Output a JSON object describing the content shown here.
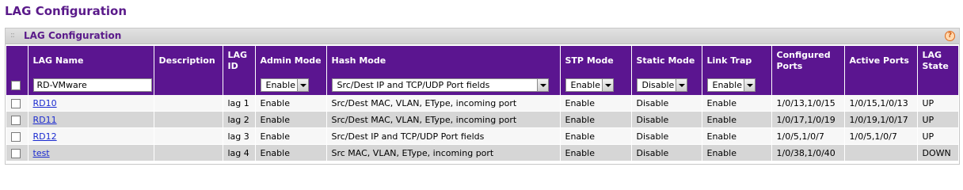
{
  "page_title": "LAG Configuration",
  "panel": {
    "title": "LAG Configuration",
    "help_icon": "help-icon"
  },
  "columns": [
    "",
    "LAG Name",
    "Description",
    "LAG ID",
    "Admin Mode",
    "Hash Mode",
    "STP Mode",
    "Static Mode",
    "Link Trap",
    "Configured Ports",
    "Active Ports",
    "LAG State"
  ],
  "filter": {
    "lag_name": "RD-VMware",
    "admin_mode": "Enable",
    "hash_mode": "Src/Dest IP and TCP/UDP Port fields",
    "stp_mode": "Enable",
    "static_mode": "Disable",
    "link_trap": "Enable"
  },
  "rows": [
    {
      "name": "RD10",
      "description": "",
      "lag_id": "lag 1",
      "admin_mode": "Enable",
      "hash_mode": "Src/Dest MAC, VLAN, EType, incoming port",
      "stp_mode": "Enable",
      "static_mode": "Disable",
      "link_trap": "Enable",
      "configured_ports": "1/0/13,1/0/15",
      "active_ports": "1/0/15,1/0/13",
      "state": "UP"
    },
    {
      "name": "RD11",
      "description": "",
      "lag_id": "lag 2",
      "admin_mode": "Enable",
      "hash_mode": "Src/Dest MAC, VLAN, EType, incoming port",
      "stp_mode": "Enable",
      "static_mode": "Disable",
      "link_trap": "Enable",
      "configured_ports": "1/0/17,1/0/19",
      "active_ports": "1/0/19,1/0/17",
      "state": "UP"
    },
    {
      "name": "RD12",
      "description": "",
      "lag_id": "lag 3",
      "admin_mode": "Enable",
      "hash_mode": "Src/Dest IP and TCP/UDP Port fields",
      "stp_mode": "Enable",
      "static_mode": "Disable",
      "link_trap": "Enable",
      "configured_ports": "1/0/5,1/0/7",
      "active_ports": "1/0/5,1/0/7",
      "state": "UP"
    },
    {
      "name": "test",
      "description": "",
      "lag_id": "lag 4",
      "admin_mode": "Enable",
      "hash_mode": "Src MAC, VLAN, EType, incoming port",
      "stp_mode": "Enable",
      "static_mode": "Disable",
      "link_trap": "Enable",
      "configured_ports": "1/0/38,1/0/40",
      "active_ports": "",
      "state": "DOWN"
    }
  ]
}
